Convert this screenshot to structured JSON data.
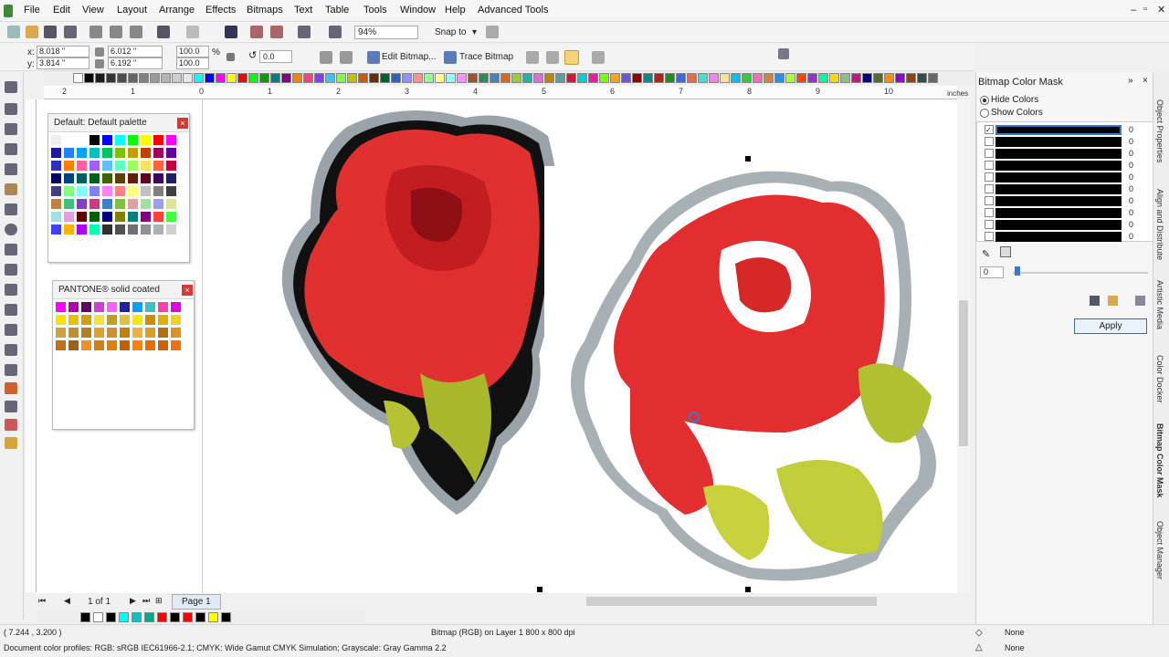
{
  "menu": {
    "items": [
      "File",
      "Edit",
      "View",
      "Layout",
      "Arrange",
      "Effects",
      "Bitmaps",
      "Text",
      "Table",
      "Tools",
      "Window",
      "Help",
      "Advanced Tools"
    ]
  },
  "toolbar": {
    "zoom": "94%",
    "snap_to": "Snap to",
    "x_label": "x:",
    "x_value": "8.018 \"",
    "y_label": "y:",
    "y_value": "3.814 \"",
    "w_value": "6.012 \"",
    "h_value": "6.192 \"",
    "scale_x": "100.0",
    "scale_y": "100.0",
    "percent": "%",
    "rotation": "0.0",
    "edit_bitmap": "Edit Bitmap...",
    "trace_bitmap": "Trace Bitmap"
  },
  "ruler": {
    "h_ticks": [
      "2",
      "1",
      "0",
      "1",
      "2",
      "3",
      "4",
      "5",
      "6",
      "7",
      "8",
      "9",
      "10"
    ],
    "unit": "inches"
  },
  "palette_colors": [
    "#ffffff",
    "#000000",
    "#1a1a1a",
    "#333333",
    "#4d4d4d",
    "#666666",
    "#808080",
    "#999999",
    "#b3b3b3",
    "#cccccc",
    "#e6e6e6",
    "#00ffff",
    "#0000ff",
    "#ff00ff",
    "#ffff00",
    "#ff0000",
    "#00ff00",
    "#00a000",
    "#008080",
    "#800080",
    "#ff8000",
    "#ff4080",
    "#8040ff",
    "#40c0ff",
    "#80ff40",
    "#c0c000",
    "#c06000",
    "#603000",
    "#006030",
    "#3060c0",
    "#9090ff",
    "#ff9090",
    "#90ff90",
    "#ffff90",
    "#90ffff",
    "#ff90ff",
    "#a0522d",
    "#2e8b57",
    "#4682b4",
    "#d2691e",
    "#9acd32",
    "#20b2aa",
    "#da70d6",
    "#b8860b",
    "#5f9ea0",
    "#dc143c",
    "#00ced1",
    "#ff1493",
    "#7cfc00",
    "#ffa500",
    "#6a5acd",
    "#8b0000",
    "#008b8b",
    "#b22222",
    "#228b22",
    "#4169e1",
    "#ff6347",
    "#40e0d0",
    "#ee82ee",
    "#f0e68c",
    "#00bfff",
    "#32cd32",
    "#ff69b4",
    "#cd853f",
    "#1e90ff",
    "#adff2f",
    "#ff4500",
    "#9932cc",
    "#00fa9a",
    "#ffd700",
    "#8fbc8f",
    "#c71585",
    "#00008b",
    "#556b2f",
    "#ff8c00",
    "#9400d3",
    "#8b4513",
    "#2f4f4f",
    "#696969"
  ],
  "docker_default": {
    "title": "Default: Default palette",
    "colors": [
      "#eeeeee",
      "#ffffff",
      "#ffffff",
      "#000000",
      "#0000ff",
      "#00ffff",
      "#00ff00",
      "#ffff00",
      "#ff0000",
      "#ff00ff",
      "#1a1aa0",
      "#2080ff",
      "#00a0ff",
      "#00c0c0",
      "#00c060",
      "#80c000",
      "#c0a000",
      "#c04000",
      "#a00060",
      "#6000a0",
      "#3030c0",
      "#ff8000",
      "#ff60a0",
      "#a060ff",
      "#60c0ff",
      "#60ffc0",
      "#a0ff60",
      "#ffe060",
      "#ff6040",
      "#c00040",
      "#000060",
      "#004080",
      "#006060",
      "#006020",
      "#406000",
      "#604000",
      "#602000",
      "#600020",
      "#400060",
      "#202060",
      "#404080",
      "#80ff80",
      "#80ffff",
      "#8080ff",
      "#ff80ff",
      "#ff8080",
      "#ffff80",
      "#c0c0c0",
      "#808080",
      "#404040",
      "#c08040",
      "#40c080",
      "#8040c0",
      "#c04080",
      "#4080c0",
      "#80c040",
      "#e0a0a0",
      "#a0e0a0",
      "#a0a0e0",
      "#e0e0a0",
      "#a0e0e0",
      "#e0a0e0",
      "#600000",
      "#006000",
      "#000080",
      "#808000",
      "#008080",
      "#800080",
      "#ff4040",
      "#40ff40",
      "#4040ff",
      "#ffb000",
      "#b000ff",
      "#00ffb0",
      "#303030",
      "#505050",
      "#707070",
      "#909090",
      "#b0b0b0",
      "#d0d0d0"
    ]
  },
  "docker_pantone": {
    "title": "PANTONE® solid coated",
    "colors": [
      "#ff00ff",
      "#b000b0",
      "#600060",
      "#d040d0",
      "#ff60ff",
      "#2020a0",
      "#00a0ff",
      "#40c0c0",
      "#ff40a0",
      "#e000e0",
      "#ffe000",
      "#e8c000",
      "#d0a000",
      "#f0e040",
      "#c0a020",
      "#e0c040",
      "#f8e800",
      "#c89000",
      "#e0b000",
      "#f0d020",
      "#d0a040",
      "#c09030",
      "#b08020",
      "#e0a030",
      "#d09030",
      "#c08000",
      "#f0b040",
      "#d8a020",
      "#b07010",
      "#e09020",
      "#c07010",
      "#a06010",
      "#f09020",
      "#d08010",
      "#e08000",
      "#c06000",
      "#ff8000",
      "#e07000",
      "#d06000",
      "#f07010"
    ]
  },
  "status": {
    "coords": "( 7.244 , 3.200 )",
    "selection": "Bitmap (RGB) on Layer 1 800 x 800 dpi",
    "profiles": "Document color profiles: RGB: sRGB IEC61966-2.1; CMYK: Wide Gamut CMYK Simulation; Grayscale: Gray Gamma 2.2",
    "fill_none": "None",
    "outline_none": "None"
  },
  "page_nav": {
    "page_of": "1 of 1",
    "page_tab": "Page 1"
  },
  "bitmap_mask": {
    "title": "Bitmap Color Mask",
    "hide_colors": "Hide Colors",
    "show_colors": "Show Colors",
    "rows": [
      "0",
      "0",
      "0",
      "0",
      "0",
      "0",
      "0",
      "0",
      "0",
      "0"
    ],
    "tolerance": "0",
    "apply": "Apply"
  },
  "side_tabs": [
    "Object Properties",
    "Align and Distribute",
    "Artistic Media",
    "Color Docker",
    "Bitmap Color Mask",
    "Object Manager"
  ]
}
